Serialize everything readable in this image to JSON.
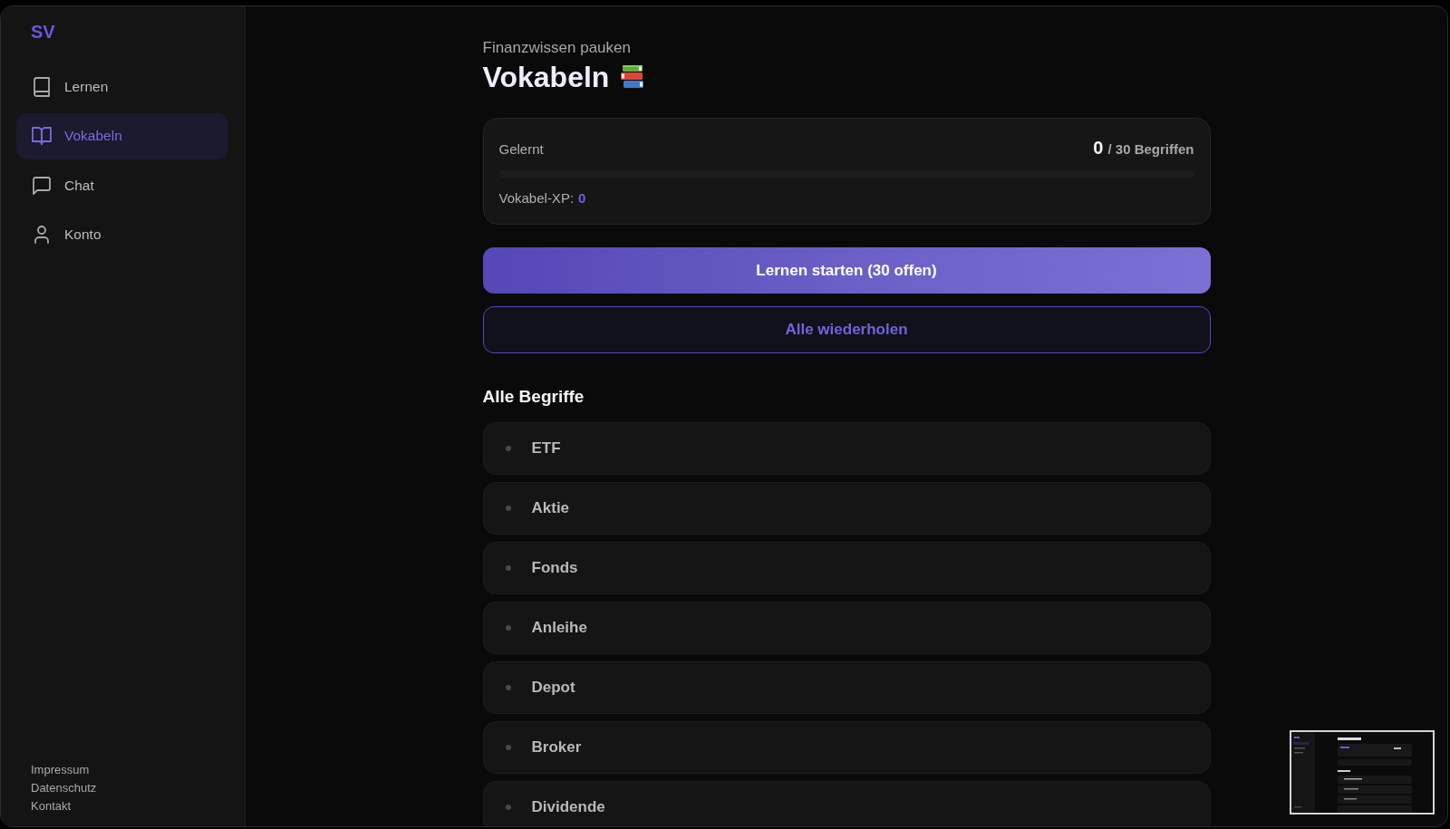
{
  "sidebar": {
    "logo": "SV",
    "items": [
      {
        "label": "Lernen",
        "selected": false
      },
      {
        "label": "Vokabeln",
        "selected": true
      },
      {
        "label": "Chat",
        "selected": false
      },
      {
        "label": "Konto",
        "selected": false
      }
    ],
    "footer_links": [
      "Impressum",
      "Datenschutz",
      "Kontakt"
    ]
  },
  "header": {
    "subtitle": "Finanzwissen pauken",
    "title": "Vokabeln"
  },
  "progress_card": {
    "label": "Gelernt",
    "count": "0",
    "total": "/ 30 Begriffen",
    "level": 0,
    "xp_label": "Vokabel-XP:",
    "xp_value": "0"
  },
  "buttons": [
    {
      "label": "Lernen starten (30 offen)",
      "kind": "primary"
    },
    {
      "label": "Alle wiederholen",
      "kind": "secondary"
    }
  ],
  "terms": {
    "heading": "Alle Begriffe",
    "items": [
      "ETF",
      "Aktie",
      "Fonds",
      "Anleihe",
      "Depot",
      "Broker",
      "Dividende"
    ]
  }
}
